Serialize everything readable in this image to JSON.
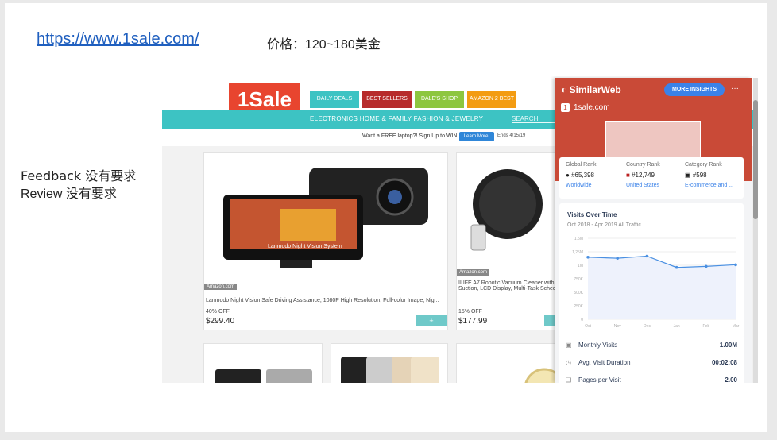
{
  "slide": {
    "url": "https://www.1sale.com/",
    "price": "价格：120~180美金",
    "feedback": "Feedback 没有要求",
    "review": "Review 没有要求"
  },
  "site": {
    "logo": "1Sale",
    "tabs": [
      {
        "label": "DAILY DEALS",
        "color": "#3dc3c3"
      },
      {
        "label": "BEST SELLERS",
        "color": "#b72b2b"
      },
      {
        "label": "DALE'S SHOP",
        "color": "#8dc63f"
      },
      {
        "label": "AMAZON 2 BEST",
        "color": "#f39c12"
      }
    ],
    "categories": "ELECTRONICS   HOME & FAMILY   FASHION & JEWELRY",
    "search": "SEARCH",
    "promo_text": "Want a FREE laptop?! Sign Up to WIN!",
    "promo_button": "Learn More!",
    "promo_ends": "Ends 4/15/19",
    "products": [
      {
        "tag": "Amazon.com",
        "title": "Lanmodo Night Vision Safe Driving Assistance, 1080P High Resolution, Full-color Image, Nig...",
        "off": "40% OFF",
        "price": "$299.40",
        "banner": "Lanmodo Night Vision System"
      },
      {
        "tag": "Amazon.com",
        "title": "ILIFE A7 Robotic Vacuum Cleaner with H... Suction, LCD Display, Multi-Task Schedu...",
        "off": "15% OFF",
        "price": "$177.99"
      }
    ],
    "cart_icon": "+"
  },
  "similarweb": {
    "brand": "SimilarWeb",
    "more": "MORE INSIGHTS",
    "dots": "···",
    "favicon": "1",
    "site": "1sale.com",
    "ranks": [
      {
        "label": "Global Rank",
        "value": "#65,398",
        "sub": "Worldwide"
      },
      {
        "label": "Country Rank",
        "value": "#12,749",
        "sub": "United States"
      },
      {
        "label": "Category Rank",
        "value": "#598",
        "sub": "E-commerce and ..."
      }
    ],
    "visits_title": "Visits Over Time",
    "visits_sub": "Oct 2018 - Apr 2019   All Traffic",
    "metrics": [
      {
        "label": "Monthly Visits",
        "value": "1.00M"
      },
      {
        "label": "Avg. Visit Duration",
        "value": "00:02:08"
      },
      {
        "label": "Pages per Visit",
        "value": "2.00"
      }
    ]
  },
  "chart_data": {
    "type": "line",
    "title": "Visits Over Time",
    "y_ticks": [
      "1.5M",
      "1,25M",
      "1M",
      "750K",
      "500K",
      "250K",
      "0"
    ],
    "ylim": [
      0,
      1500000
    ],
    "x_ticks": [
      "Oct",
      "Nov",
      "Dec",
      "Jan",
      "Feb",
      "Mar"
    ],
    "series": [
      {
        "values": [
          1150000,
          1130000,
          1170000,
          960000,
          980000,
          1010000
        ]
      }
    ]
  }
}
